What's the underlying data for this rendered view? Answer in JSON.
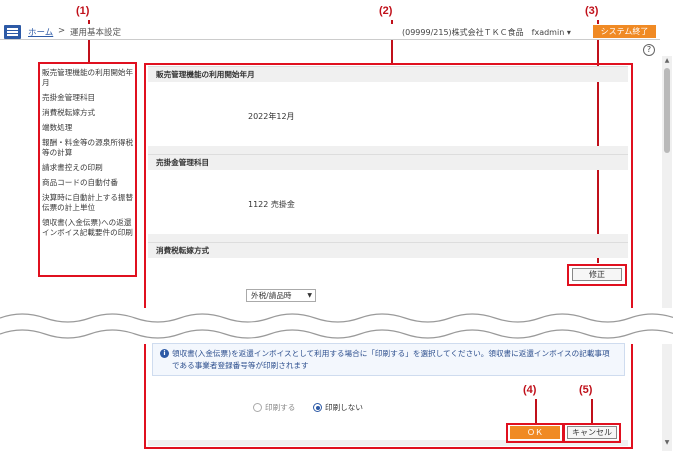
{
  "header": {
    "breadcrumb_home": "ホーム",
    "breadcrumb_sep": ">",
    "breadcrumb_current": "運用基本設定",
    "user_info": "(09999/215)株式会社ＴＫＣ食品　fxadmin ▾",
    "exit_label": "システム終了",
    "help_symbol": "?"
  },
  "callouts": [
    "(1)",
    "(2)",
    "(3)",
    "(4)",
    "(5)"
  ],
  "sidebar": {
    "items": [
      "販売管理機能の利用開始年月",
      "売掛金管理科目",
      "消費税転嫁方式",
      "端数処理",
      "報酬・料金等の源泉所得税等の計算",
      "請求書控えの印刷",
      "商品コードの自動付番",
      "決算時に自動計上する振替伝票の計上単位",
      "領収書(入金伝票)への返還インボイス記載要件の印刷"
    ]
  },
  "main": {
    "section1": {
      "title": "販売管理機能の利用開始年月",
      "value": "2022年12月"
    },
    "section2": {
      "title": "売掛金管理科目",
      "value": "1122 売掛金"
    },
    "section3": {
      "title": "消費税転嫁方式",
      "edit_label": "修正",
      "select_value": "外税/請品時"
    },
    "info_text": "領収書(入金伝票)を返還インボイスとして利用する場合に「印刷する」を選択してください。領収書に返還インボイスの記載事項である事業者登録番号等が印刷されます",
    "radio_print": "印刷する",
    "radio_noprint": "印刷しない",
    "ok_label": "ＯＫ",
    "cancel_label": "キャンセル"
  },
  "colors": {
    "accent": "#f08a24",
    "brand": "#2d5aa6",
    "annotation": "#e0101f"
  }
}
